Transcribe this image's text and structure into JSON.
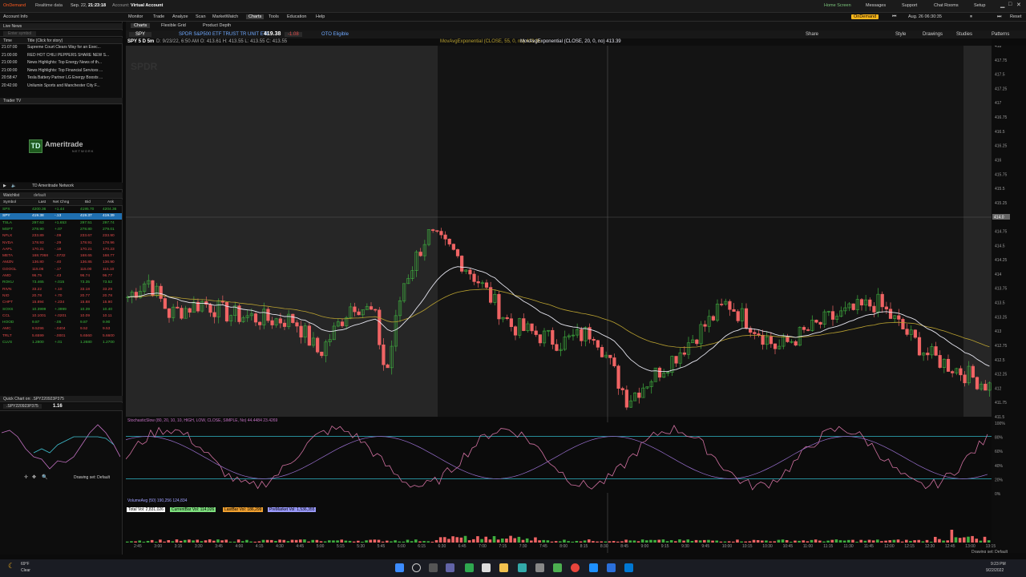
{
  "topbar": {
    "ondemand_label": "OnDemand",
    "realtime_label": "Realtime data",
    "date_text": "Sep. 22,",
    "time_text": "21:23:18",
    "account_label": "Account:",
    "account_value": "Virtual Account",
    "home_screen": "Home Screen",
    "messages": "Messages",
    "support": "Support",
    "chat_rooms": "Chat Rooms",
    "setup": "Setup",
    "ondemand_badge": "OnDemand",
    "ondemand_date": "Aug. 26 06:30:35",
    "reset": "Reset"
  },
  "nav": {
    "items": [
      "Monitor",
      "Trade",
      "Analyze",
      "Scan",
      "MarketWatch",
      "Charts",
      "Tools",
      "Education",
      "Help"
    ]
  },
  "chart_tabs": {
    "items": [
      "Charts",
      "Flexible Grid",
      "Product Depth"
    ]
  },
  "toolbar": {
    "symbol": "SPY",
    "description": "SPDR S&P500 ETF TRUST TR UNIT ETF",
    "last_price": "419.38",
    "change": "-1.08",
    "exchange_tag": "OTO Eligible",
    "share": "Share",
    "style": "Style",
    "drawings": "Drawings",
    "studies": "Studies",
    "patterns": "Patterns"
  },
  "statusbar": {
    "label": "SPY 5 D 5m",
    "ohlc": "D: 9/23/22, 6:50 AM  O: 413.61  H: 413.55  L: 413.55  C: 413.55",
    "mav1": "MovAvgExponential (CLOSE, 55, 0, no)  413.35",
    "mav2": "MovAvgExponential (CLOSE, 20, 0, no)  413.39",
    "watermark": "SPDR"
  },
  "left_panel": {
    "account_info": "Account Info",
    "live_news": "Live News",
    "news_filter": "Enter symbol",
    "news_col_time": "Time",
    "news_col_title": "Title (Click for story)",
    "news": [
      {
        "time": "21:07:00",
        "title": "Supreme Court Clears Way for an Exec..."
      },
      {
        "time": "21:00:00",
        "title": "RED HOT CHILI PEPPERS SHARE NEW S..."
      },
      {
        "time": "21:00:00",
        "title": "News Highlights: Top Energy News of th..."
      },
      {
        "time": "21:00:00",
        "title": "News Highlights: Top Financial Services ..."
      },
      {
        "time": "20:58:47",
        "title": "Tesla Battery Partner LG Energy Boosts ..."
      },
      {
        "time": "20:42:00",
        "title": "Unilumin Sports and Manchester City F..."
      }
    ],
    "trader_tv": "Trader TV",
    "ameritrade_logo": "Ameritrade",
    "ameritrade_sub": "NETWORK",
    "tv_channel": "TD Ameritrade Network",
    "watchlist_label": "Watchlist",
    "watchlist_name": "default",
    "wl_headers": [
      "Symbol",
      "Last",
      "Net Chng",
      "Bid",
      "Ask"
    ],
    "watchlist": [
      {
        "sym": "SPX",
        "last": "4200.36",
        "chg": "+1.44",
        "bid": "4195.70",
        "ask": "4204.36",
        "color": "#3fbf3f"
      },
      {
        "sym": "SPY",
        "last": "419.38",
        "chg": "-.13",
        "bid": "419.37",
        "ask": "419.39",
        "color": "#ffffff"
      },
      {
        "sym": "TSLA",
        "last": "297.63",
        "chg": "+1.653",
        "bid": "297.51",
        "ask": "297.74",
        "color": "#3fbf3f"
      },
      {
        "sym": "MSFT",
        "last": "278.90",
        "chg": "+.07",
        "bid": "278.80",
        "ask": "279.01",
        "color": "#3fbf3f"
      },
      {
        "sym": "NFLX",
        "last": "233.89",
        "chg": "-.09",
        "bid": "233.67",
        "ask": "233.90",
        "color": "#e34a4a"
      },
      {
        "sym": "NVDA",
        "last": "178.93",
        "chg": "-.29",
        "bid": "178.91",
        "ask": "178.96",
        "color": "#e34a4a"
      },
      {
        "sym": "AAPL",
        "last": "170.21",
        "chg": "-.18",
        "bid": "170.21",
        "ask": "170.23",
        "color": "#e34a4a"
      },
      {
        "sym": "META",
        "last": "168.7068",
        "chg": "-.0732",
        "bid": "168.65",
        "ask": "168.77",
        "color": "#e34a4a"
      },
      {
        "sym": "AMZN",
        "last": "136.80",
        "chg": "-.40",
        "bid": "136.85",
        "ask": "136.90",
        "color": "#e34a4a"
      },
      {
        "sym": "GOOGL",
        "last": "115.06",
        "chg": "-.17",
        "bid": "115.00",
        "ask": "115.10",
        "color": "#e34a4a"
      },
      {
        "sym": "AMD",
        "last": "96.75",
        "chg": "-.43",
        "bid": "96.74",
        "ask": "96.77",
        "color": "#e34a4a"
      },
      {
        "sym": "ROKU",
        "last": "73.465",
        "chg": "+.015",
        "bid": "73.35",
        "ask": "73.52",
        "color": "#3fbf3f"
      },
      {
        "sym": "RIVN",
        "last": "33.22",
        "chg": "+.10",
        "bid": "33.18",
        "ask": "33.29",
        "color": "#e34a4a"
      },
      {
        "sym": "NIO",
        "last": "20.78",
        "chg": "+.70",
        "bid": "20.77",
        "ask": "20.78",
        "color": "#e34a4a"
      },
      {
        "sym": "CHPT",
        "last": "15.894",
        "chg": "+.234",
        "bid": "15.88",
        "ask": "15.90",
        "color": "#e34a4a"
      },
      {
        "sym": "SOXS",
        "last": "10.3999",
        "chg": "+.3999",
        "bid": "10.39",
        "ask": "10.40",
        "color": "#3fbf3f"
      },
      {
        "sym": "CCL",
        "last": "10.1001",
        "chg": "+.0201",
        "bid": "10.09",
        "ask": "10.11",
        "color": "#e34a4a"
      },
      {
        "sym": "HOOD",
        "last": "9.87",
        "chg": "-.05",
        "bid": "9.87",
        "ask": "9.90",
        "color": "#3fbf3f"
      },
      {
        "sym": "AMC",
        "last": "9.5296",
        "chg": "-.0404",
        "bid": "9.52",
        "ask": "9.53",
        "color": "#e34a4a"
      },
      {
        "sym": "TRLT",
        "last": "5.6599",
        "chg": "-.0001",
        "bid": "5.6560",
        "ask": "5.6600",
        "color": "#e34a4a"
      },
      {
        "sym": "CLVS",
        "last": "1.2800",
        "chg": "+.01",
        "bid": "1.2680",
        "ask": "1.2700",
        "color": "#3fbf3f"
      }
    ],
    "quick_chart": "Quick Chart on: .SPY220923P375",
    "quick_symbol": ".SPY220923P375",
    "quick_price": "1.16",
    "drawing_set": "Drawing set: Default"
  },
  "lower_panels": {
    "stoch_label": "StochasticSlow (80, 20, 10, 10, HIGH, LOW, CLOSE, SIMPLE, No)  44.4484  23.4269",
    "vol_label": "VolumeAvg (50)  190,256  124,834",
    "vol_badges": [
      {
        "text": "Total Vol: 2,831,026",
        "color": "#ffffff"
      },
      {
        "text": "CurrentBar Vol: 114,026",
        "color": "#7ee07e"
      },
      {
        "text": "LastBar Vol: 186,299",
        "color": "#f0a030"
      },
      {
        "text": "PreMarket Vol: 1,536,355",
        "color": "#9a9aff"
      }
    ],
    "drawing_set_bottom": "Drawing set: Default"
  },
  "taskbar": {
    "weather_temp": "69°F",
    "weather_desc": "Clear",
    "time": "9:23 PM",
    "date": "9/22/2022"
  },
  "chart_data": {
    "type": "candlestick",
    "instrument": "SPY",
    "timeframe": "5 D 5m",
    "ylim": [
      411.5,
      418
    ],
    "price_ticks": [
      "418",
      "417.75",
      "417.5",
      "417.25",
      "417",
      "416.75",
      "416.5",
      "416.25",
      "416",
      "415.75",
      "415.5",
      "415.25",
      "415",
      "414.75",
      "414.5",
      "414.25",
      "414",
      "413.75",
      "413.5",
      "413.25",
      "413",
      "412.75",
      "412.5",
      "412.25",
      "412",
      "411.75",
      "411.5"
    ],
    "time_ticks": [
      "2:45",
      "3:00",
      "3:15",
      "3:30",
      "3:45",
      "4:00",
      "4:15",
      "4:30",
      "4:45",
      "5:00",
      "5:15",
      "5:30",
      "5:45",
      "6:00",
      "6:15",
      "6:30",
      "6:45",
      "7:00",
      "7:15",
      "7:30",
      "7:45",
      "8:00",
      "8:15",
      "8:30",
      "8:45",
      "9:00",
      "9:15",
      "9:30",
      "9:45",
      "10:00",
      "10:15",
      "10:30",
      "10:45",
      "11:00",
      "11:15",
      "11:30",
      "11:45",
      "12:00",
      "12:15",
      "12:30",
      "12:45",
      "13:00",
      "13:15"
    ],
    "current_price": "414.0",
    "stoch_ticks": [
      "100%",
      "80%",
      "60%",
      "40%",
      "20%",
      "0%"
    ]
  },
  "colors": {
    "up": "#3fae3f",
    "down": "#f06464",
    "ema_fast": "#e6e6f0",
    "ema_slow": "#b8a030",
    "accent": "#ffb81c"
  }
}
